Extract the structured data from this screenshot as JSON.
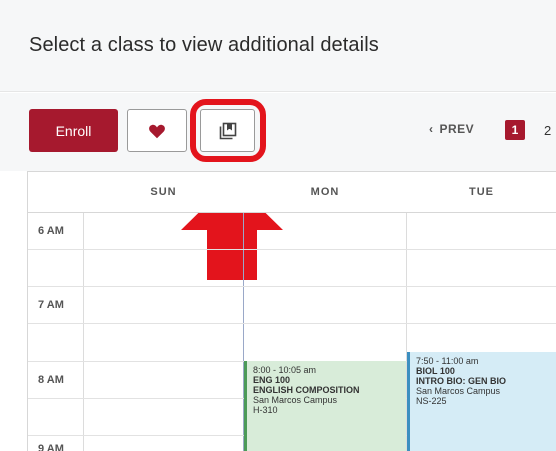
{
  "page": {
    "title": "Select a class to view additional details"
  },
  "toolbar": {
    "enroll_label": "Enroll",
    "favorite_icon": "heart-icon",
    "save_icon": "bookmark-copy-icon",
    "accent_color": "#a6192e",
    "highlight_color": "#e3141c"
  },
  "pagination": {
    "prev_label": "PREV",
    "current_page": "1",
    "next_page": "2"
  },
  "calendar": {
    "days": [
      "SUN",
      "MON",
      "TUE"
    ],
    "times": [
      "6 AM",
      "7 AM",
      "8 AM",
      "9 AM"
    ],
    "events": [
      {
        "day": "MON",
        "time": "8:00 - 10:05 am",
        "code": "ENG 100",
        "name": "ENGLISH COMPOSITION",
        "campus": "San Marcos Campus",
        "room": "H-310",
        "color": "#d8ecd9"
      },
      {
        "day": "TUE",
        "time": "7:50 - 11:00 am",
        "code": "BIOL 100",
        "name": "INTRO BIO: GEN BIO",
        "campus": "San Marcos Campus",
        "room": "NS-225",
        "color": "#d5ecf6"
      }
    ]
  }
}
